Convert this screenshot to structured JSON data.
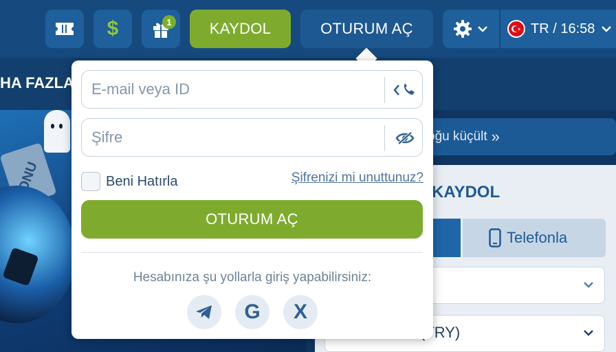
{
  "header": {
    "gift_badge_count": "1",
    "register_label": "KAYDOL",
    "login_label": "OTURUM AÇ",
    "lang_time": "TR / 16:58",
    "icons": [
      "coupon-icon",
      "dollar-icon",
      "gift-icon",
      "gear-icon",
      "chevron-down-icon",
      "turkey-flag-icon"
    ]
  },
  "background": {
    "nav_more_text": "HA FAZLA",
    "reduce_text": "oğu küçült",
    "ticket_text": "BONU",
    "register_title": "KAYDOL",
    "phone_tab_label": "Telefonla",
    "currency_partial": "(TRY)"
  },
  "login_popup": {
    "email_placeholder": "E-mail veya ID",
    "password_placeholder": "Şifre",
    "remember_label": "Beni Hatırla",
    "forgot_label": "Şifrenizi mi unuttunuz?",
    "submit_label": "OTURUM AÇ",
    "social_caption": "Hesabınıza şu yollarla giriş yapabilirsiniz:",
    "social_icons": [
      "telegram-icon",
      "google-icon",
      "x-icon"
    ]
  },
  "colors": {
    "header_bg": "#164a7e",
    "accent_green": "#7eab2e",
    "button_blue": "#1e5f9c",
    "text_blue": "#1d5a96"
  }
}
